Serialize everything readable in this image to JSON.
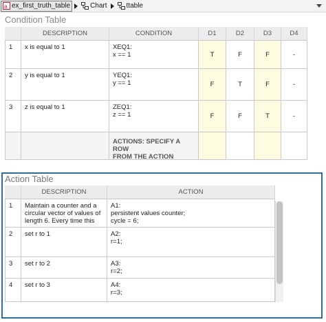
{
  "breadcrumb": {
    "items": [
      {
        "label": "ex_first_truth_table",
        "icon": "model-icon"
      },
      {
        "label": "Chart",
        "icon": "chart-icon"
      },
      {
        "label": "ttable",
        "icon": "truth-table-icon"
      }
    ]
  },
  "condition_table": {
    "title": "Condition Table",
    "headers": [
      "DESCRIPTION",
      "CONDITION",
      "D1",
      "D2",
      "D3",
      "D4"
    ],
    "rows": [
      {
        "num": "1",
        "description": "x is equal to 1",
        "condition_l1": "XEQ1:",
        "condition_l2": "x == 1",
        "d": [
          "T",
          "F",
          "F",
          "-"
        ]
      },
      {
        "num": "2",
        "description": "y is equal to 1",
        "condition_l1": "YEQ1:",
        "condition_l2": "y == 1",
        "d": [
          "F",
          "T",
          "F",
          "-"
        ]
      },
      {
        "num": "3",
        "description": "z is equal to 1",
        "condition_l1": "ZEQ1:",
        "condition_l2": "z == 1",
        "d": [
          "F",
          "F",
          "T",
          "-"
        ]
      }
    ],
    "actions_row_l1": "ACTIONS: SPECIFY A ROW",
    "actions_row_l2": "FROM THE ACTION TABLE"
  },
  "action_table": {
    "title": "Action Table",
    "headers": [
      "DESCRIPTION",
      "ACTION"
    ],
    "rows": [
      {
        "num": "1",
        "description_lines": [
          "Maintain a counter and a",
          "circular vector of values of",
          "length 6. Every time this"
        ],
        "action_lines": [
          "A1:",
          "persistent values counter;",
          "cycle = 6;"
        ]
      },
      {
        "num": "2",
        "description_lines": [
          "set r to 1"
        ],
        "action_lines": [
          "A2:",
          "r=1;"
        ]
      },
      {
        "num": "3",
        "description_lines": [
          "set r to 2"
        ],
        "action_lines": [
          "A3:",
          "r=2;"
        ]
      },
      {
        "num": "4",
        "description_lines": [
          "set r to 3"
        ],
        "action_lines": [
          "A4:",
          "r=3;"
        ]
      }
    ]
  },
  "colors": {
    "highlight_column": "#fdfbe0",
    "frame_accent": "#2f6e9b"
  }
}
